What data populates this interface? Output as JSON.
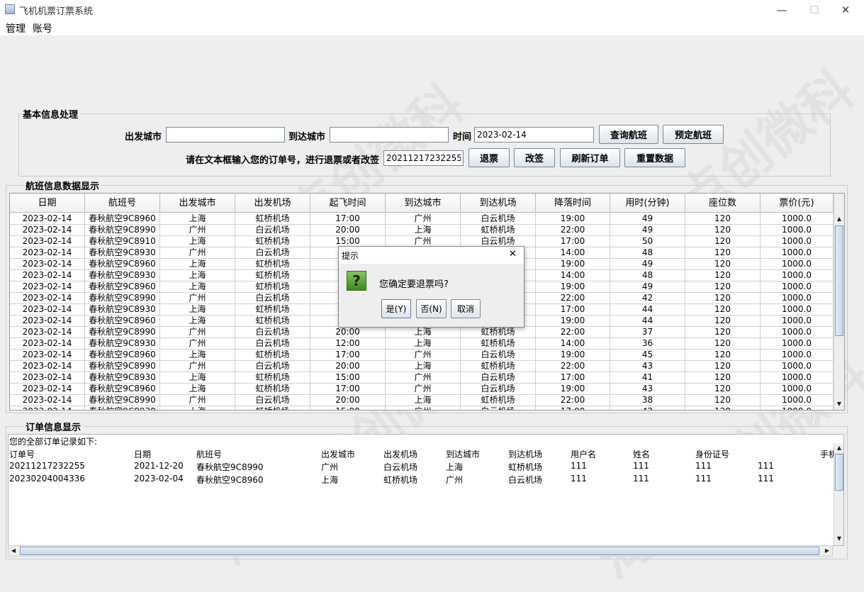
{
  "window": {
    "title": "飞机机票订票系统",
    "minimize": "—",
    "maximize": "☐",
    "close": "✕"
  },
  "menu": [
    {
      "label": "管理"
    },
    {
      "label": "账号"
    }
  ],
  "basic_panel": {
    "title": "基本信息处理",
    "from_city_label": "出发城市",
    "from_city_value": "",
    "to_city_label": "到达城市",
    "to_city_value": "",
    "time_label": "时间",
    "time_value": "2023-02-14",
    "query_button": "查询航班",
    "book_button": "预定航班",
    "order_prompt": "请在文本框输入您的订单号，进行退票或者改签",
    "order_value": "20211217232255",
    "refund_button": "退票",
    "change_button": "改签",
    "refresh_button": "刷新订单",
    "reset_button": "重置数据"
  },
  "flight_panel": {
    "title": "航班信息数据显示",
    "columns": [
      "日期",
      "航班号",
      "出发城市",
      "出发机场",
      "起飞时间",
      "到达城市",
      "到达机场",
      "降落时间",
      "用时(分钟)",
      "座位数",
      "票价(元)"
    ],
    "rows": [
      [
        "2023-02-14",
        "春秋航空9C8960",
        "上海",
        "虹桥机场",
        "17:00",
        "广州",
        "白云机场",
        "19:00",
        "49",
        "120",
        "1000.0"
      ],
      [
        "2023-02-14",
        "春秋航空9C8990",
        "广州",
        "白云机场",
        "20:00",
        "上海",
        "虹桥机场",
        "22:00",
        "49",
        "120",
        "1000.0"
      ],
      [
        "2023-02-14",
        "春秋航空9C8910",
        "上海",
        "虹桥机场",
        "15:00",
        "广州",
        "白云机场",
        "17:00",
        "50",
        "120",
        "1000.0"
      ],
      [
        "2023-02-14",
        "春秋航空9C8930",
        "广州",
        "白云机场",
        "",
        "",
        "",
        "14:00",
        "48",
        "120",
        "1000.0"
      ],
      [
        "2023-02-14",
        "春秋航空9C8960",
        "上海",
        "虹桥机场",
        "",
        "",
        "",
        "19:00",
        "49",
        "120",
        "1000.0"
      ],
      [
        "2023-02-14",
        "春秋航空9C8930",
        "上海",
        "虹桥机场",
        "",
        "",
        "",
        "14:00",
        "48",
        "120",
        "1000.0"
      ],
      [
        "2023-02-14",
        "春秋航空9C8960",
        "上海",
        "虹桥机场",
        "",
        "",
        "",
        "19:00",
        "49",
        "120",
        "1000.0"
      ],
      [
        "2023-02-14",
        "春秋航空9C8990",
        "广州",
        "白云机场",
        "2",
        "",
        "",
        "22:00",
        "42",
        "120",
        "1000.0"
      ],
      [
        "2023-02-14",
        "春秋航空9C8930",
        "上海",
        "虹桥机场",
        "",
        "",
        "",
        "17:00",
        "44",
        "120",
        "1000.0"
      ],
      [
        "2023-02-14",
        "春秋航空9C8960",
        "上海",
        "虹桥机场",
        "",
        "",
        "",
        "19:00",
        "44",
        "120",
        "1000.0"
      ],
      [
        "2023-02-14",
        "春秋航空9C8990",
        "广州",
        "白云机场",
        "20:00",
        "上海",
        "虹桥机场",
        "22:00",
        "37",
        "120",
        "1000.0"
      ],
      [
        "2023-02-14",
        "春秋航空9C8930",
        "广州",
        "白云机场",
        "12:00",
        "上海",
        "虹桥机场",
        "14:00",
        "36",
        "120",
        "1000.0"
      ],
      [
        "2023-02-14",
        "春秋航空9C8960",
        "上海",
        "虹桥机场",
        "17:00",
        "广州",
        "白云机场",
        "19:00",
        "45",
        "120",
        "1000.0"
      ],
      [
        "2023-02-14",
        "春秋航空9C8990",
        "广州",
        "白云机场",
        "20:00",
        "上海",
        "虹桥机场",
        "22:00",
        "43",
        "120",
        "1000.0"
      ],
      [
        "2023-02-14",
        "春秋航空9C8930",
        "上海",
        "虹桥机场",
        "15:00",
        "广州",
        "白云机场",
        "17:00",
        "41",
        "120",
        "1000.0"
      ],
      [
        "2023-02-14",
        "春秋航空9C8960",
        "上海",
        "虹桥机场",
        "17:00",
        "广州",
        "白云机场",
        "19:00",
        "43",
        "120",
        "1000.0"
      ],
      [
        "2023-02-14",
        "春秋航空9C8990",
        "广州",
        "白云机场",
        "20:00",
        "上海",
        "虹桥机场",
        "22:00",
        "38",
        "120",
        "1000.0"
      ],
      [
        "2023-02-14",
        "春秋航空9C8930",
        "上海",
        "虹桥机场",
        "15:00",
        "广州",
        "白云机场",
        "17:00",
        "42",
        "120",
        "1000.0"
      ]
    ]
  },
  "order_panel": {
    "title": "订单信息显示",
    "intro": "您的全部订单记录如下:",
    "columns": [
      "订单号",
      "日期",
      "航班号",
      "出发城市",
      "出发机场",
      "到达城市",
      "到达机场",
      "用户名",
      "姓名",
      "身份证号",
      "手机"
    ],
    "rows": [
      [
        "20211217232255",
        "2021-12-20",
        "春秋航空9C8990",
        "广州",
        "白云机场",
        "上海",
        "虹桥机场",
        "111",
        "111",
        "111",
        "111"
      ],
      [
        "20230204004336",
        "2023-02-04",
        "春秋航空9C8960",
        "上海",
        "虹桥机场",
        "广州",
        "白云机场",
        "111",
        "111",
        "111",
        "111"
      ]
    ]
  },
  "dialog": {
    "title": "提示",
    "icon": "question-icon",
    "icon_glyph": "?",
    "message": "您确定要退票吗?",
    "yes": "是(Y)",
    "no": "否(N)",
    "cancel": "取消",
    "close": "✕"
  },
  "watermark": "淘宝/点创微科",
  "colors": {
    "accent": "#7f9db9",
    "dialog_icon": "#5aa02c"
  }
}
